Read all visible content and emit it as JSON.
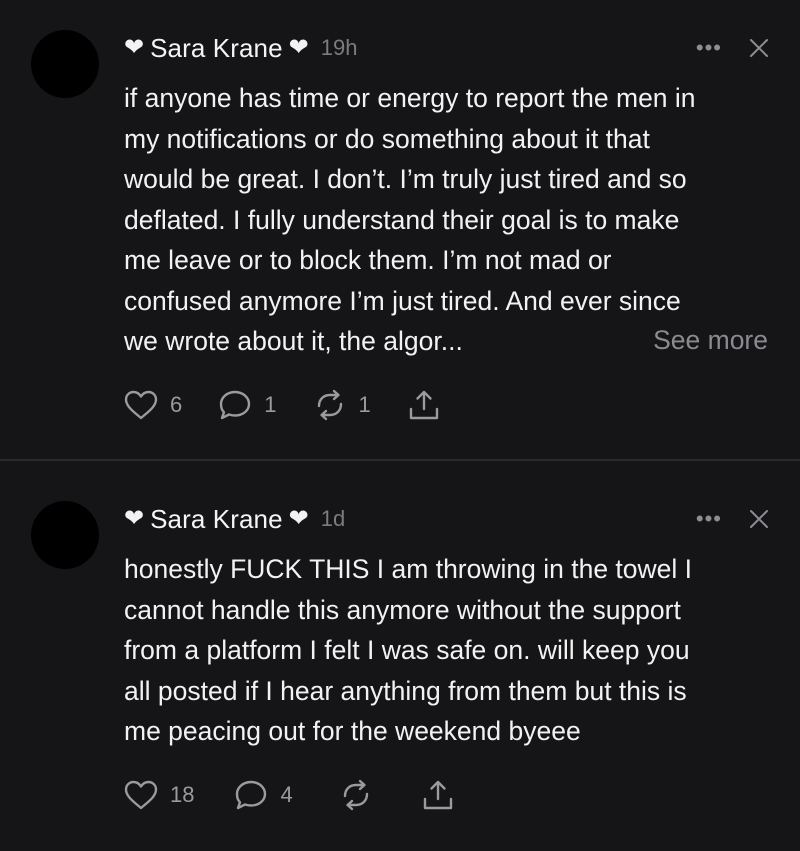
{
  "posts": [
    {
      "author": "Sara Krane",
      "author_prefix_glyph": "❤",
      "author_suffix_glyph": "❤",
      "timestamp": "19h",
      "more_label": "•••",
      "text": "if anyone has time or energy to report the men in\nmy notifications or do something about it that\nwould be great. I don’t. I’m truly just tired and so\ndeflated. I fully understand their goal is to make\nme leave or to block them. I’m not mad or\nconfused anymore I’m just tired. And ever since\nwe wrote about it, the algor...",
      "see_more_label": "See more",
      "likes": "6",
      "replies": "1",
      "reposts": "1"
    },
    {
      "author": "Sara Krane",
      "author_prefix_glyph": "❤",
      "author_suffix_glyph": "❤",
      "timestamp": "1d",
      "more_label": "•••",
      "text": "honestly FUCK THIS I am throwing in the towel I\ncannot handle this anymore without the support\nfrom a platform I felt I was safe on. will keep you\nall posted if I hear anything from them but this is\nme peacing out for the weekend byeee",
      "likes": "18",
      "replies": "4"
    }
  ],
  "icons": {
    "like": "heart-outline-icon",
    "reply": "speech-bubble-icon",
    "repost": "repost-arrows-icon",
    "share": "share-upload-icon",
    "close": "close-x-icon"
  },
  "colors": {
    "background": "#151517",
    "text": "#f2f2f2",
    "muted": "#7c7c80",
    "divider": "#2a2a2d"
  }
}
